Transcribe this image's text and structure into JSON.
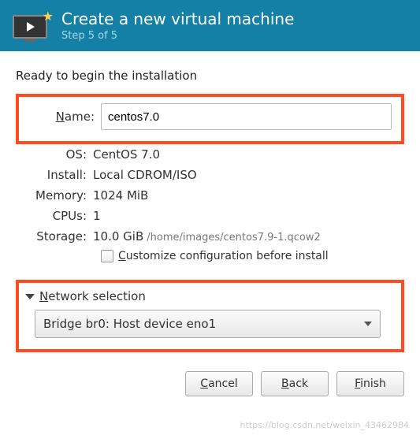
{
  "header": {
    "title": "Create a new virtual machine",
    "step": "Step 5 of 5"
  },
  "ready_text": "Ready to begin the installation",
  "fields": {
    "name_label_prefix": "N",
    "name_label_rest": "ame:",
    "name_value": "centos7.0",
    "os_label": "OS:",
    "os_value": "CentOS 7.0",
    "install_label": "Install:",
    "install_value": "Local CDROM/ISO",
    "memory_label": "Memory:",
    "memory_value": "1024 MiB",
    "cpus_label": "CPUs:",
    "cpus_value": "1",
    "storage_label": "Storage:",
    "storage_value": "10.0 GiB",
    "storage_path": "/home/images/centos7.9-1.qcow2"
  },
  "customize": {
    "label_prefix": "C",
    "label_rest": "ustomize configuration before install"
  },
  "network": {
    "expander_prefix": "N",
    "expander_rest": "etwork selection",
    "selected": "Bridge br0: Host device eno1"
  },
  "buttons": {
    "cancel_u": "C",
    "cancel_r": "ancel",
    "back_u": "B",
    "back_r": "ack",
    "finish_u": "F",
    "finish_r": "inish"
  },
  "watermark": "https://blog.csdn.net/weixin_43462984"
}
